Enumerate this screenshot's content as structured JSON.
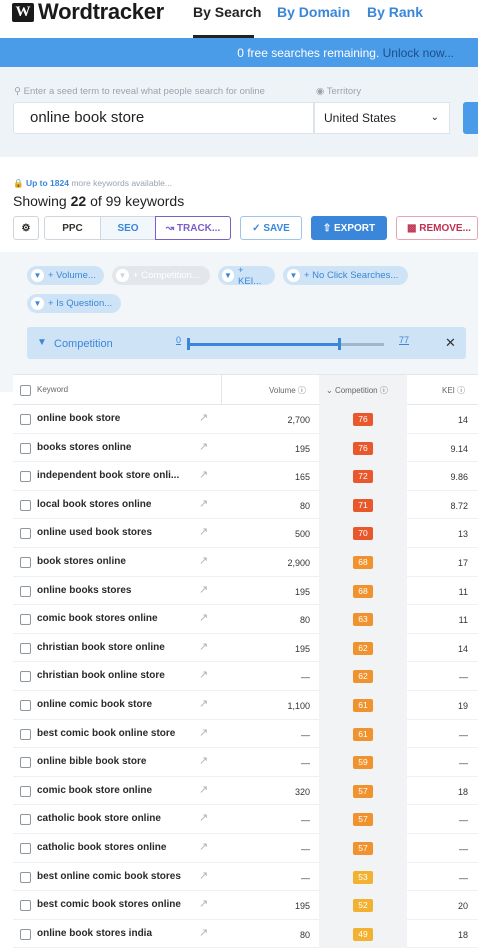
{
  "brand": {
    "logo_mark": "W",
    "name": "Wordtracker"
  },
  "nav": {
    "tabs": [
      "By Search",
      "By Domain",
      "By Rank"
    ]
  },
  "banner": {
    "text": "0 free searches remaining.",
    "link": "Unlock now..."
  },
  "search": {
    "hint": "Enter a seed term to reveal what people search for online",
    "territory_label": "Territory",
    "query": "online book store",
    "territory": "United States"
  },
  "summary": {
    "lock_prefix": "Up to 1824",
    "lock_suffix": "more keywords available...",
    "showing_prefix": "Showing",
    "shown": "22",
    "showing_suffix": "of 99 keywords"
  },
  "toolbar": {
    "ppc": "PPC",
    "seo": "SEO",
    "track": "TRACK...",
    "save": "SAVE",
    "export": "EXPORT",
    "remove": "REMOVE..."
  },
  "filters": {
    "chips": [
      "+ Volume...",
      "+ Competition...",
      "+ KEI...",
      "+ No Click Searches...",
      "+ Is Question..."
    ],
    "competition": {
      "label": "Competition",
      "min": "0",
      "max": "77",
      "range": [
        0,
        77
      ],
      "selected": [
        0,
        59
      ]
    }
  },
  "table": {
    "headers": {
      "keyword": "Keyword",
      "volume": "Volume",
      "competition": "Competition",
      "kei": "KEI"
    },
    "rows": [
      {
        "kw": "online book store",
        "vol": "2,700",
        "comp": "76",
        "kei": "14"
      },
      {
        "kw": "books stores online",
        "vol": "195",
        "comp": "76",
        "kei": "9.14"
      },
      {
        "kw": "independent book store onli...",
        "vol": "165",
        "comp": "72",
        "kei": "9.86"
      },
      {
        "kw": "local book stores online",
        "vol": "80",
        "comp": "71",
        "kei": "8.72"
      },
      {
        "kw": "online used book stores",
        "vol": "500",
        "comp": "70",
        "kei": "13"
      },
      {
        "kw": "book stores online",
        "vol": "2,900",
        "comp": "68",
        "kei": "17"
      },
      {
        "kw": "online books stores",
        "vol": "195",
        "comp": "68",
        "kei": "11"
      },
      {
        "kw": "comic book stores online",
        "vol": "80",
        "comp": "63",
        "kei": "11"
      },
      {
        "kw": "christian book store online",
        "vol": "195",
        "comp": "62",
        "kei": "14"
      },
      {
        "kw": "christian book online store",
        "vol": "—",
        "comp": "62",
        "kei": "—"
      },
      {
        "kw": "online comic book store",
        "vol": "1,100",
        "comp": "61",
        "kei": "19"
      },
      {
        "kw": "best comic book online store",
        "vol": "—",
        "comp": "61",
        "kei": "—"
      },
      {
        "kw": "online bible book store",
        "vol": "—",
        "comp": "59",
        "kei": "—"
      },
      {
        "kw": "comic book store online",
        "vol": "320",
        "comp": "57",
        "kei": "18"
      },
      {
        "kw": "catholic book store online",
        "vol": "—",
        "comp": "57",
        "kei": "—"
      },
      {
        "kw": "catholic book stores online",
        "vol": "—",
        "comp": "57",
        "kei": "—"
      },
      {
        "kw": "best online comic book stores",
        "vol": "—",
        "comp": "53",
        "kei": "—"
      },
      {
        "kw": "best comic book stores online",
        "vol": "195",
        "comp": "52",
        "kei": "20"
      },
      {
        "kw": "online book stores india",
        "vol": "80",
        "comp": "49",
        "kei": "18"
      }
    ]
  },
  "colors": {
    "accent": "#3a86d9",
    "comp_high": "#e8582c",
    "comp_mid": "#f0922e",
    "comp_low": "#f2b130"
  }
}
